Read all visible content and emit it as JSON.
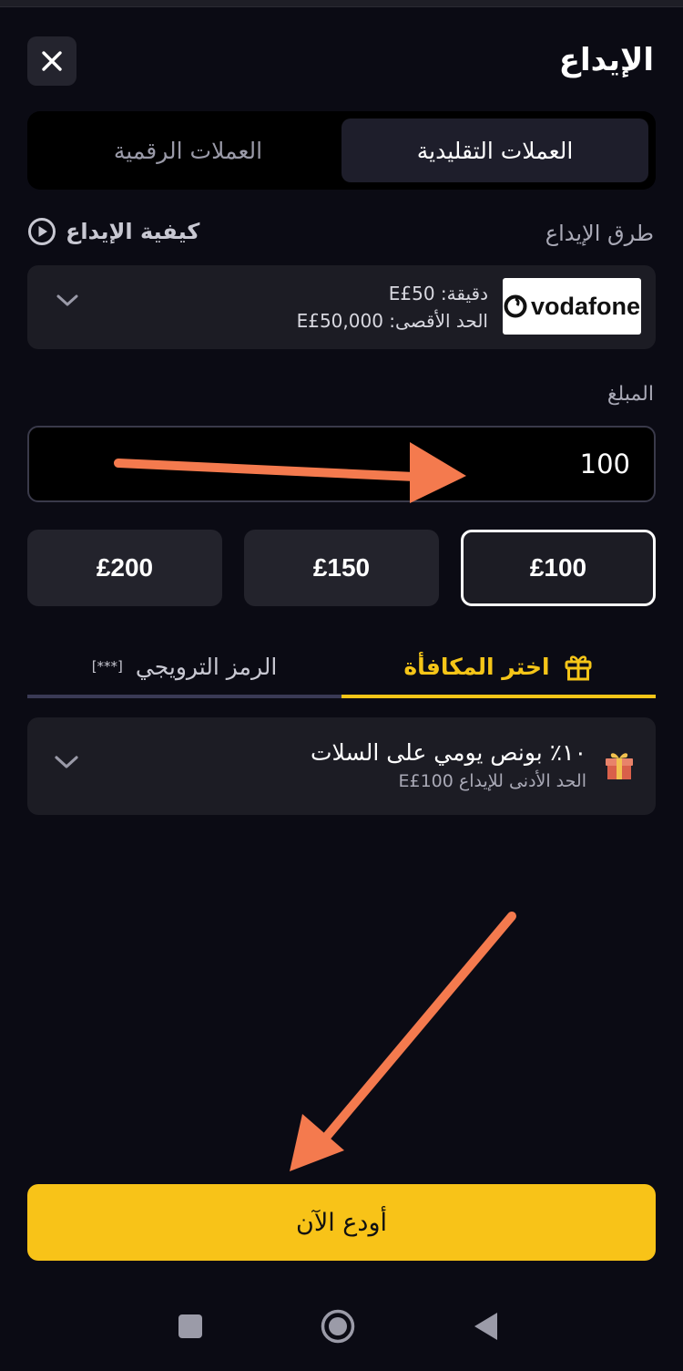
{
  "header": {
    "title": "الإيداع"
  },
  "currency_tabs": {
    "fiat": "العملات التقليدية",
    "crypto": "العملات الرقمية"
  },
  "methods": {
    "label": "طرق الإيداع",
    "how_to": "كيفية الإيداع",
    "selected": {
      "brand": "vodafone",
      "min": "دقيقة: E£50",
      "max": "الحد الأقصى: E£50,000"
    }
  },
  "amount": {
    "label": "المبلغ",
    "value": "100"
  },
  "quick_amounts": [
    {
      "label": "£100",
      "selected": true
    },
    {
      "label": "£150",
      "selected": false
    },
    {
      "label": "£200",
      "selected": false
    }
  ],
  "bonus_tabs": {
    "choose_bonus": "اختر المكافأة",
    "promo_code": "الرمز الترويجي",
    "promo_stars": "[***]"
  },
  "bonus": {
    "title": "١٠٪ بونص يومي على السلات",
    "subtitle": "الحد الأدنى للإيداع E£100"
  },
  "deposit_button": "أودع الآن",
  "colors": {
    "accent": "#f8c318",
    "background": "#0b0b14",
    "card": "#1c1c24",
    "annotation_arrow": "#f47a4e"
  }
}
